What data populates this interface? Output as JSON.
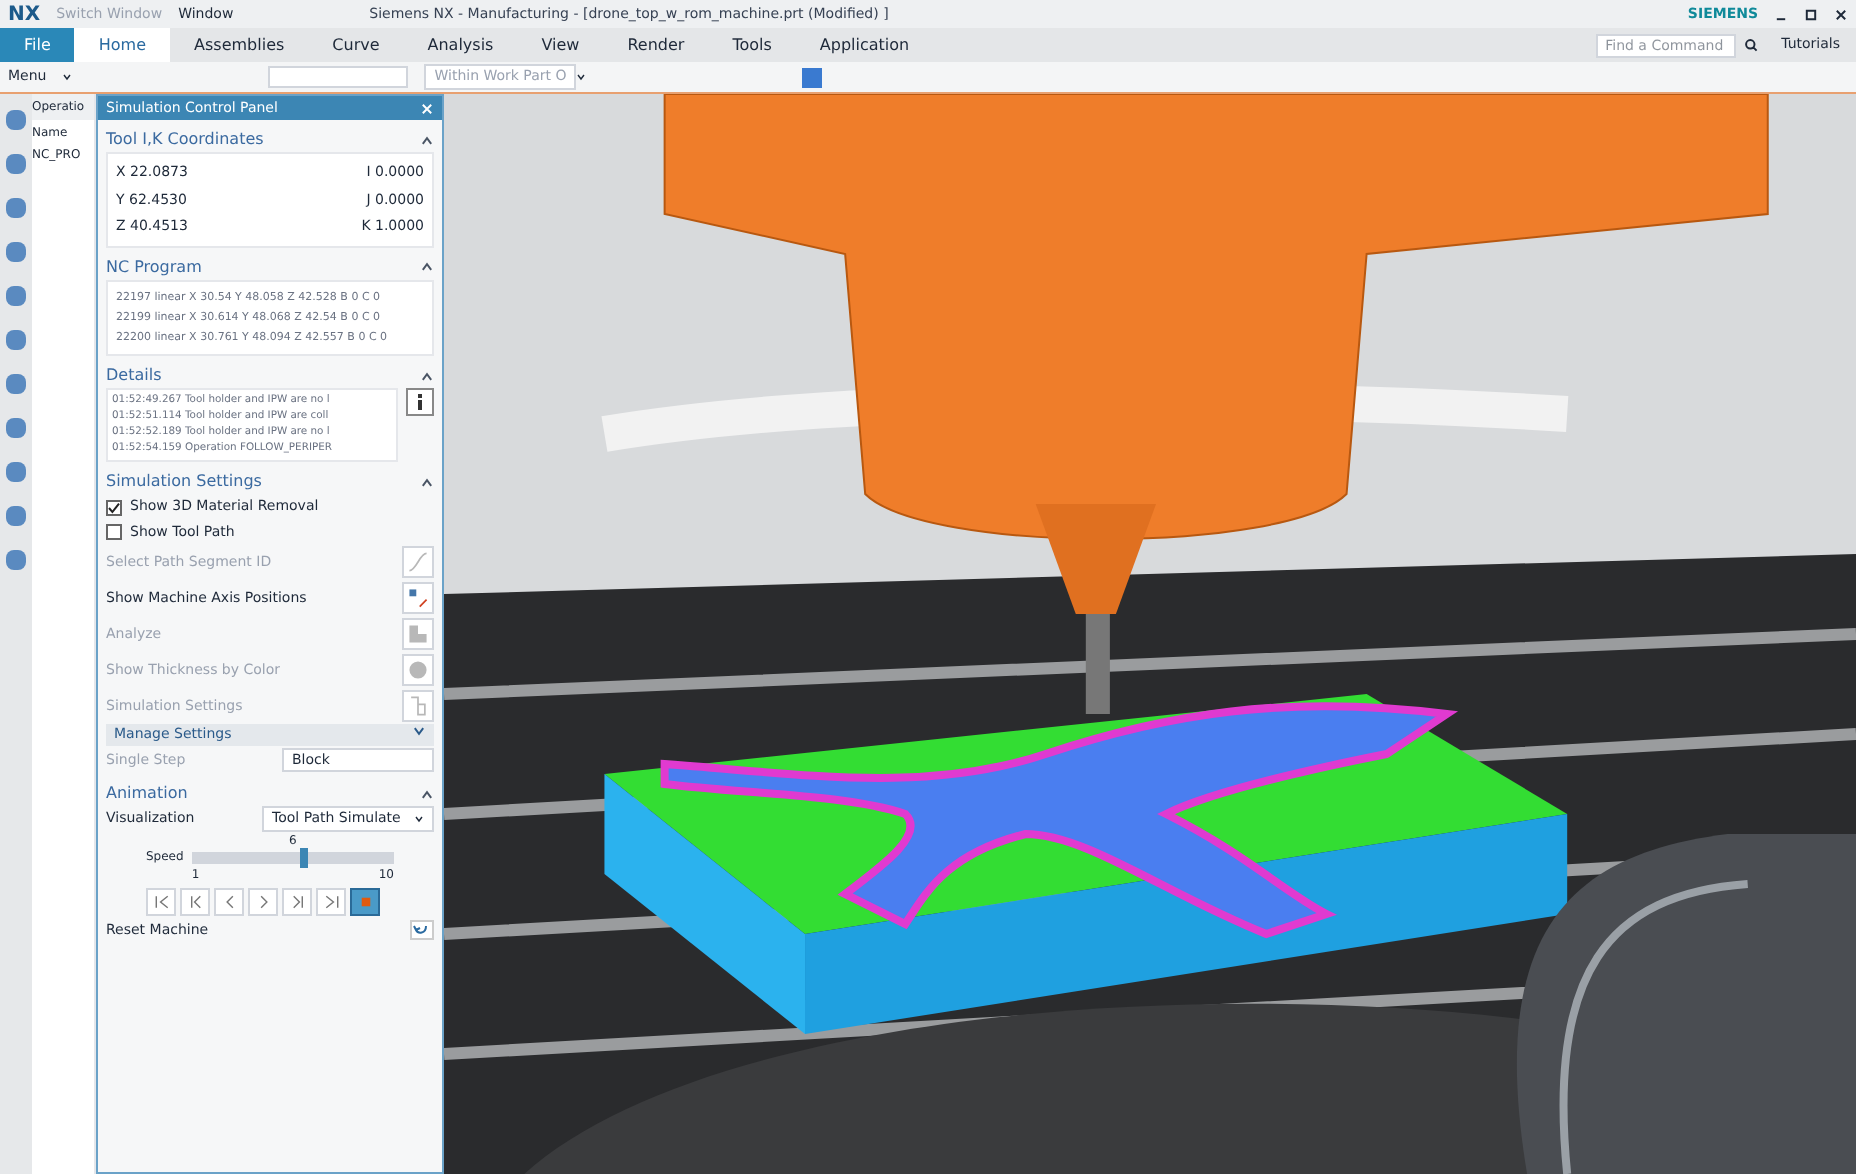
{
  "title_bar": {
    "logo": "NX",
    "quick_access": [
      "Switch Window",
      "Window"
    ],
    "title": "Siemens NX - Manufacturing - [drone_top_w_rom_machine.prt (Modified) ]",
    "brand": "SIEMENS"
  },
  "tabs": [
    {
      "label": "File",
      "kind": "file",
      "selected": false
    },
    {
      "label": "Home",
      "kind": "tab",
      "selected": true
    },
    {
      "label": "Assemblies",
      "kind": "tab",
      "selected": false
    },
    {
      "label": "Curve",
      "kind": "tab",
      "selected": false
    },
    {
      "label": "Analysis",
      "kind": "tab",
      "selected": false
    },
    {
      "label": "View",
      "kind": "tab",
      "selected": false
    },
    {
      "label": "Render",
      "kind": "tab",
      "selected": false
    },
    {
      "label": "Tools",
      "kind": "tab",
      "selected": false
    },
    {
      "label": "Application",
      "kind": "tab",
      "selected": false
    }
  ],
  "command_search": {
    "placeholder": "Find a Command"
  },
  "tutorials": "Tutorials",
  "toolbar": {
    "menu": "Menu",
    "filter": "Within Work Part O"
  },
  "navigator": {
    "title": "Operatio",
    "column": "Name",
    "root": "NC_PRO"
  },
  "panel": {
    "title": "Simulation Control Panel",
    "coordinates": {
      "title": "Tool I,K Coordinates",
      "rows": [
        [
          "X 22.0873",
          "I 0.0000"
        ],
        [
          "Y 62.4530",
          "J 0.0000"
        ],
        [
          "Z 40.4513",
          "K 1.0000"
        ]
      ]
    },
    "nc_program": {
      "title": "NC Program",
      "lines": [
        "22197 linear X 30.54 Y 48.058 Z 42.528 B 0 C 0",
        "22199 linear X 30.614 Y 48.068 Z 42.54 B 0 C 0",
        "22200 linear X 30.761 Y 48.094 Z 42.557 B 0 C 0"
      ]
    },
    "details": {
      "title": "Details",
      "lines": [
        "01:52:49.267 Tool holder and IPW are no l",
        "01:52:51.114 Tool holder and IPW are coll",
        "01:52:52.189 Tool holder and IPW are no l",
        "01:52:54.159 Operation FOLLOW_PERIPER"
      ]
    },
    "simulation_settings": {
      "title": "Simulation Settings",
      "checkboxes": [
        {
          "label": "Show 3D Material Removal",
          "checked": true
        },
        {
          "label": "Show Tool Path",
          "checked": false
        }
      ],
      "options": [
        {
          "label": "Select Path Segment ID",
          "disabled": true,
          "kind": "curve"
        },
        {
          "label": "Show Machine Axis Positions",
          "disabled": false,
          "kind": "axes"
        },
        {
          "label": "Analyze",
          "disabled": true,
          "kind": "analyze"
        },
        {
          "label": "Show Thickness by Color",
          "disabled": true,
          "kind": "thickness"
        },
        {
          "label": "Simulation Settings",
          "disabled": true,
          "kind": "settings"
        }
      ],
      "manage": {
        "label": "Manage Settings",
        "expanded": false
      },
      "single_step": {
        "label": "Single Step",
        "value": "Block"
      }
    },
    "animation": {
      "title": "Animation",
      "visualization_label": "Visualization",
      "visualization": "Tool Path Simulate",
      "speed_label": "Speed",
      "speed_value": "6",
      "speed_min": "1",
      "speed_max": "10",
      "level": 0.556,
      "controls": [
        {
          "kind": "first",
          "selected": false
        },
        {
          "kind": "step-back",
          "selected": false
        },
        {
          "kind": "play-back",
          "selected": false
        },
        {
          "kind": "play",
          "selected": false
        },
        {
          "kind": "step",
          "selected": false
        },
        {
          "kind": "last",
          "selected": false
        },
        {
          "kind": "stop",
          "selected": true
        }
      ],
      "reset": "Reset Machine"
    }
  }
}
